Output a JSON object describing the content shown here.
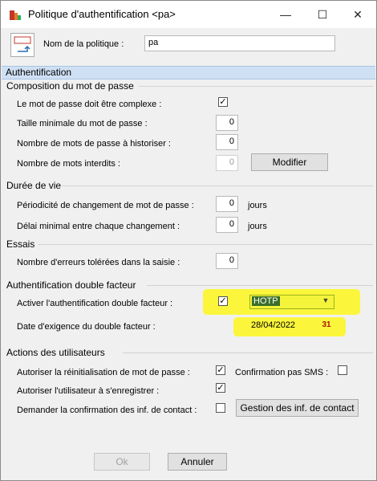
{
  "window": {
    "title": "Politique d'authentification <pa>",
    "minimize": "—",
    "maximize": "☐",
    "close": "✕"
  },
  "header": {
    "policy_name_label": "Nom de la politique :",
    "policy_name_value": "pa"
  },
  "section_title": "Authentification",
  "password": {
    "group_label": "Composition du mot de passe",
    "complex_label": "Le mot de passe doit être complexe :",
    "complex_checked": "✓",
    "min_length_label": "Taille minimale du mot de passe :",
    "min_length_value": "0",
    "history_label": "Nombre de mots de passe à historiser :",
    "history_value": "0",
    "forbidden_label": "Nombre de mots interdits :",
    "forbidden_value": "0",
    "modify_button": "Modifier"
  },
  "lifetime": {
    "group_label": "Durée de vie",
    "change_period_label": "Périodicité de changement de mot de passe :",
    "change_period_value": "0",
    "change_period_unit": "jours",
    "min_delay_label": "Délai minimal entre chaque changement :",
    "min_delay_value": "0",
    "min_delay_unit": "jours"
  },
  "attempts": {
    "group_label": "Essais",
    "errors_label": "Nombre d'erreurs tolérées dans la saisie :",
    "errors_value": "0"
  },
  "two_factor": {
    "group_label": "Authentification double facteur",
    "enable_label": "Activer l'authentification double facteur :",
    "enable_checked": "✓",
    "method_value": "HOTP",
    "date_label": "Date d'exigence du double facteur :",
    "date_value": "28/04/2022",
    "calendar_icon_text": "31",
    "highlight_color": "#fbf63b"
  },
  "user_actions": {
    "group_label": "Actions des utilisateurs",
    "reset_label": "Autoriser la réinitialisation de mot de passe :",
    "reset_checked": "✓",
    "sms_label": "Confirmation pas SMS :",
    "register_label": "Autoriser l'utilisateur à s'enregistrer :",
    "register_checked": "✓",
    "confirm_contact_label": "Demander la confirmation des inf. de contact :",
    "contact_button": "Gestion des inf. de contact"
  },
  "footer": {
    "ok_button": "Ok",
    "cancel_button": "Annuler"
  },
  "colors": {
    "section_bar": "#cfe0f4",
    "dialog_bg": "#f0f0f0"
  }
}
